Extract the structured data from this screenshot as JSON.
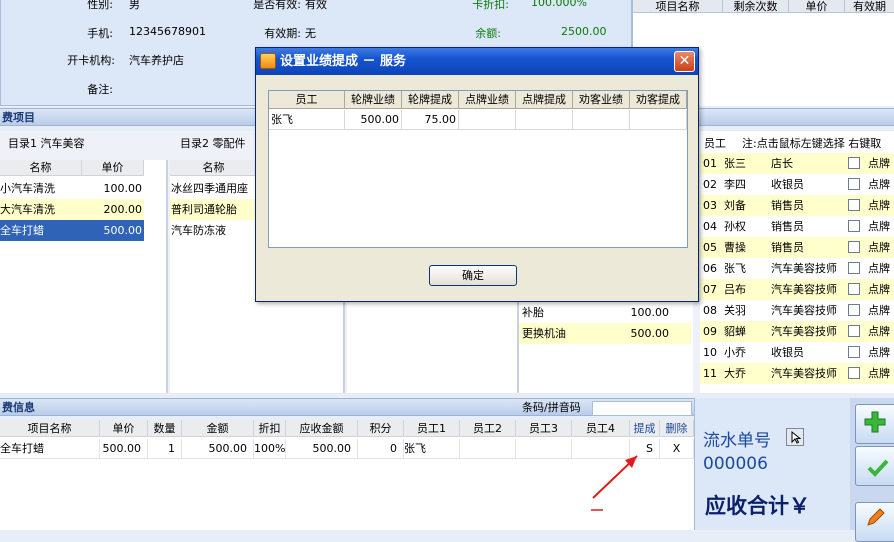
{
  "member": {
    "gender_label": "性别:",
    "gender_value": "男",
    "valid_label": "是否有效:",
    "valid_value": "有效",
    "discount_label": "卡折扣:",
    "discount_value": "100.000%",
    "phone_label": "手机:",
    "phone_value": "12345678901",
    "expiry_label": "有效期:",
    "expiry_value": "无",
    "balance_label": "余额:",
    "balance_value": "2500.00",
    "org_label": "开卡机构:",
    "org_value": "汽车养护店",
    "note_label": "备注:"
  },
  "card_items_table": {
    "headers": [
      "项目名称",
      "剩余次数",
      "单价",
      "有效期"
    ]
  },
  "section_project": {
    "title": "费项目"
  },
  "catalog1": {
    "tab_label": "目录1 汽车美容",
    "headers": [
      "名称",
      "单价"
    ],
    "rows": [
      {
        "name": "小汽车清洗",
        "price": "100.00"
      },
      {
        "name": "大汽车清洗",
        "price": "200.00"
      },
      {
        "name": "全车打蜡",
        "price": "500.00"
      }
    ]
  },
  "catalog2": {
    "tab_label": "目录2 零配件",
    "headers": [
      "名称"
    ],
    "rows": [
      {
        "name": "冰丝四季通用座"
      },
      {
        "name": "普利司通轮胎"
      },
      {
        "name": "汽车防冻液"
      }
    ]
  },
  "catalog3": {
    "rows": [
      {
        "name": "补胎",
        "price": "100.00"
      },
      {
        "name": "更换机油",
        "price": "500.00"
      }
    ]
  },
  "employees": {
    "header": "员工",
    "hint": "注:点击鼠标左键选择 右键取",
    "rows": [
      {
        "id": "01",
        "name": "张三",
        "role": "店长",
        "tag": "点牌"
      },
      {
        "id": "02",
        "name": "李四",
        "role": "收银员",
        "tag": "点牌"
      },
      {
        "id": "03",
        "name": "刘备",
        "role": "销售员",
        "tag": "点牌"
      },
      {
        "id": "04",
        "name": "孙权",
        "role": "销售员",
        "tag": "点牌"
      },
      {
        "id": "05",
        "name": "曹操",
        "role": "销售员",
        "tag": "点牌"
      },
      {
        "id": "06",
        "name": "张飞",
        "role": "汽车美容技师",
        "tag": "点牌"
      },
      {
        "id": "07",
        "name": "吕布",
        "role": "汽车美容技师",
        "tag": "点牌"
      },
      {
        "id": "08",
        "name": "关羽",
        "role": "汽车美容技师",
        "tag": "点牌"
      },
      {
        "id": "09",
        "name": "貂蝉",
        "role": "汽车美容技师",
        "tag": "点牌"
      },
      {
        "id": "10",
        "name": "小乔",
        "role": "收银员",
        "tag": "点牌"
      },
      {
        "id": "11",
        "name": "大乔",
        "role": "汽车美容技师",
        "tag": "点牌"
      }
    ]
  },
  "section_consume": {
    "title": "费信息",
    "barcode_label": "条码/拼音码",
    "barcode_value": ""
  },
  "consume_table": {
    "headers": [
      "项目名称",
      "单价",
      "数量",
      "金额",
      "折扣",
      "应收金额",
      "积分",
      "员工1",
      "员工2",
      "员工3",
      "员工4",
      "提成",
      "删除"
    ],
    "rows": [
      {
        "name": "全车打蜡",
        "price": "500.00",
        "qty": "1",
        "amount": "500.00",
        "discount": "100%",
        "receivable": "500.00",
        "points": "0",
        "emp1": "张飞",
        "emp2": "",
        "emp3": "",
        "emp4": "",
        "commission": "S",
        "delete": "X"
      }
    ]
  },
  "summary": {
    "serial_label": "流水单号",
    "serial_value": "000006",
    "total_label": "应收合计￥"
  },
  "dialog": {
    "title": "设置业绩提成 － 服务",
    "close_label": "✕",
    "headers": [
      "员工",
      "轮牌业绩",
      "轮牌提成",
      "点牌业绩",
      "点牌提成",
      "劝客业绩",
      "劝客提成"
    ],
    "rows": [
      {
        "emp": "张飞",
        "rotate_perf": "500.00",
        "rotate_comm": "75.00",
        "point_perf": "",
        "point_comm": "",
        "persuade_perf": "",
        "persuade_comm": ""
      }
    ],
    "ok_label": "确定"
  },
  "colors": {
    "accent": "#2f63b8",
    "highlight": "#ffffcc",
    "green_text": "#0a7a0a",
    "annotation_red": "#e11b1b"
  }
}
